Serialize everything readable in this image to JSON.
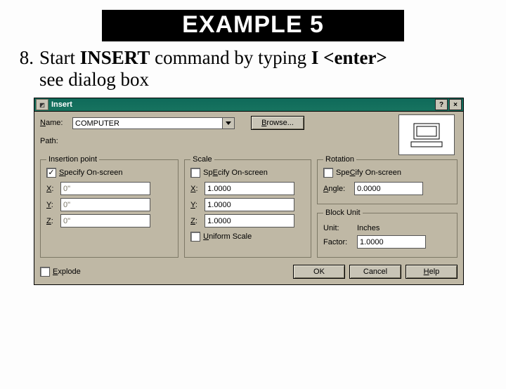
{
  "slide": {
    "title": "EXAMPLE 5"
  },
  "item": {
    "number": "8.",
    "line1_a": "Start ",
    "line1_b": "INSERT",
    "line1_c": " command by typing ",
    "line1_d": "I <enter>",
    "line2": "see dialog box"
  },
  "dialog": {
    "title": "Insert",
    "help_btn": "?",
    "close_btn": "×",
    "name_label": "Name:",
    "name_accel": "N",
    "name_value": "COMPUTER",
    "browse_label": "Browse...",
    "browse_accel": "B",
    "path_label": "Path:",
    "insertion": {
      "legend": "Insertion point",
      "specify_label": "Specify On-screen",
      "specify_accel": "S",
      "specify_checked": true,
      "x_label": "X:",
      "x_accel": "X",
      "x_value": "0\"",
      "y_label": "Y:",
      "y_accel": "Y",
      "y_value": "0\"",
      "z_label": "Z:",
      "z_accel": "Z",
      "z_value": "0\""
    },
    "scale": {
      "legend": "Scale",
      "specify_label": "Specify On-screen",
      "specify_accel": "E",
      "specify_checked": false,
      "x_label": "X:",
      "x_accel": "X",
      "x_value": "1.0000",
      "y_label": "Y:",
      "y_accel": "Y",
      "y_value": "1.0000",
      "z_label": "Z:",
      "z_accel": "Z",
      "z_value": "1.0000",
      "uniform_label": "Uniform Scale",
      "uniform_accel": "U",
      "uniform_checked": false
    },
    "rotation": {
      "legend": "Rotation",
      "specify_label": "Specify On-screen",
      "specify_accel": "C",
      "specify_checked": false,
      "angle_label": "Angle:",
      "angle_accel": "A",
      "angle_value": "0.0000"
    },
    "blockunit": {
      "legend": "Block Unit",
      "unit_label": "Unit:",
      "unit_value": "Inches",
      "factor_label": "Factor:",
      "factor_value": "1.0000"
    },
    "explode": {
      "label": "Explode",
      "accel": "E",
      "checked": false
    },
    "buttons": {
      "ok": "OK",
      "cancel": "Cancel",
      "help": "Help",
      "help_accel": "H"
    }
  }
}
